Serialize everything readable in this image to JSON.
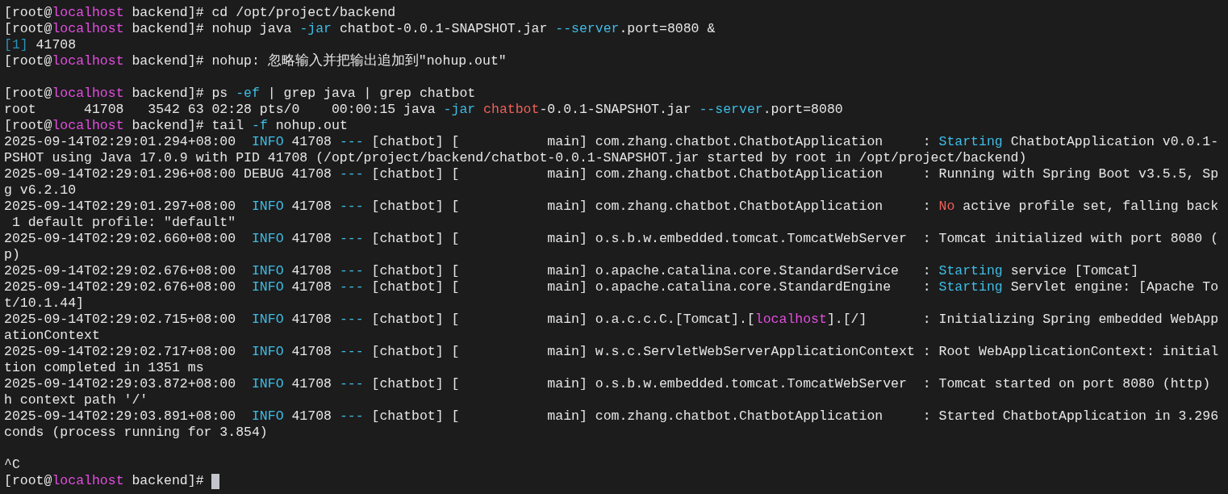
{
  "terminal": {
    "cursor_visible": true,
    "lines": [
      {
        "kind": "text",
        "segments": [
          {
            "text": "[root@"
          },
          {
            "text": "localhost",
            "color": "#e24ee0"
          },
          {
            "text": " backend]# cd /opt/project/backend"
          }
        ]
      },
      {
        "kind": "text",
        "segments": [
          {
            "text": "[root@"
          },
          {
            "text": "localhost",
            "color": "#e24ee0"
          },
          {
            "text": " backend]# nohup java "
          },
          {
            "text": "-jar",
            "color": "#3ebde6"
          },
          {
            "text": " chatbot-0.0.1-SNAPSHOT.jar "
          },
          {
            "text": "--server",
            "color": "#3ebde6"
          },
          {
            "text": ".port=8080 &"
          }
        ]
      },
      {
        "kind": "text",
        "segments": [
          {
            "text": "[1]",
            "color": "#2a93b8"
          },
          {
            "text": " 41708"
          }
        ]
      },
      {
        "kind": "text",
        "segments": [
          {
            "text": "[root@"
          },
          {
            "text": "localhost",
            "color": "#e24ee0"
          },
          {
            "text": " backend]# nohup: 忽略输入并把输出追加到\"nohup.out\""
          }
        ]
      },
      {
        "kind": "blank"
      },
      {
        "kind": "text",
        "segments": [
          {
            "text": "[root@"
          },
          {
            "text": "localhost",
            "color": "#e24ee0"
          },
          {
            "text": " backend]# ps "
          },
          {
            "text": "-ef",
            "color": "#3ebde6"
          },
          {
            "text": " | grep java | grep chatbot"
          }
        ]
      },
      {
        "kind": "text",
        "segments": [
          {
            "text": "root      41708   3542 63 02:28 pts/0    00:00:15 java "
          },
          {
            "text": "-jar ",
            "color": "#3ebde6"
          },
          {
            "text": "chatbot",
            "color": "#f0605a"
          },
          {
            "text": "-0.0.1-SNAPSHOT.jar "
          },
          {
            "text": "--server",
            "color": "#3ebde6"
          },
          {
            "text": ".port=8080"
          }
        ]
      },
      {
        "kind": "text",
        "segments": [
          {
            "text": "[root@"
          },
          {
            "text": "localhost",
            "color": "#e24ee0"
          },
          {
            "text": " backend]# tail "
          },
          {
            "text": "-f",
            "color": "#3ebde6"
          },
          {
            "text": " nohup.out"
          }
        ]
      },
      {
        "kind": "text",
        "segments": [
          {
            "text": "2025-09-14T02:29:01.294+08:00  "
          },
          {
            "text": "INFO",
            "color": "#3ebde6"
          },
          {
            "text": " 41708 "
          },
          {
            "text": "---",
            "color": "#3ebde6"
          },
          {
            "text": " [chatbot] [           main] com.zhang.chatbot.ChatbotApplication     : "
          },
          {
            "text": "Starting",
            "color": "#3ebde6"
          },
          {
            "text": " ChatbotApplication v0.0.1-"
          }
        ]
      },
      {
        "kind": "text",
        "segments": [
          {
            "text": "PSHOT using Java 17.0.9 with PID 41708 (/opt/project/backend/chatbot-0.0.1-SNAPSHOT.jar started by root in /opt/project/backend)"
          }
        ]
      },
      {
        "kind": "text",
        "segments": [
          {
            "text": "2025-09-14T02:29:01.296+08:00 DEBUG 41708 "
          },
          {
            "text": "---",
            "color": "#3ebde6"
          },
          {
            "text": " [chatbot] [           main] com.zhang.chatbot.ChatbotApplication     : Running with Spring Boot v3.5.5, Sp"
          }
        ]
      },
      {
        "kind": "text",
        "segments": [
          {
            "text": "g v6.2.10"
          }
        ]
      },
      {
        "kind": "text",
        "segments": [
          {
            "text": "2025-09-14T02:29:01.297+08:00  "
          },
          {
            "text": "INFO",
            "color": "#3ebde6"
          },
          {
            "text": " 41708 "
          },
          {
            "text": "---",
            "color": "#3ebde6"
          },
          {
            "text": " [chatbot] [           main] com.zhang.chatbot.ChatbotApplication     : "
          },
          {
            "text": "No",
            "color": "#f0605a"
          },
          {
            "text": " active profile set, falling back"
          }
        ]
      },
      {
        "kind": "text",
        "segments": [
          {
            "text": " 1 default profile: \"default\""
          }
        ]
      },
      {
        "kind": "text",
        "segments": [
          {
            "text": "2025-09-14T02:29:02.660+08:00  "
          },
          {
            "text": "INFO",
            "color": "#3ebde6"
          },
          {
            "text": " 41708 "
          },
          {
            "text": "---",
            "color": "#3ebde6"
          },
          {
            "text": " [chatbot] [           main] o.s.b.w.embedded.tomcat.TomcatWebServer  : Tomcat initialized with port 8080 ("
          }
        ]
      },
      {
        "kind": "text",
        "segments": [
          {
            "text": "p)"
          }
        ]
      },
      {
        "kind": "text",
        "segments": [
          {
            "text": "2025-09-14T02:29:02.676+08:00  "
          },
          {
            "text": "INFO",
            "color": "#3ebde6"
          },
          {
            "text": " 41708 "
          },
          {
            "text": "---",
            "color": "#3ebde6"
          },
          {
            "text": " [chatbot] [           main] o.apache.catalina.core.StandardService   : "
          },
          {
            "text": "Starting",
            "color": "#3ebde6"
          },
          {
            "text": " service [Tomcat]"
          }
        ]
      },
      {
        "kind": "text",
        "segments": [
          {
            "text": "2025-09-14T02:29:02.676+08:00  "
          },
          {
            "text": "INFO",
            "color": "#3ebde6"
          },
          {
            "text": " 41708 "
          },
          {
            "text": "---",
            "color": "#3ebde6"
          },
          {
            "text": " [chatbot] [           main] o.apache.catalina.core.StandardEngine    : "
          },
          {
            "text": "Starting",
            "color": "#3ebde6"
          },
          {
            "text": " Servlet engine: [Apache To"
          }
        ]
      },
      {
        "kind": "text",
        "segments": [
          {
            "text": "t/10.1.44]"
          }
        ]
      },
      {
        "kind": "text",
        "segments": [
          {
            "text": "2025-09-14T02:29:02.715+08:00  "
          },
          {
            "text": "INFO",
            "color": "#3ebde6"
          },
          {
            "text": " 41708 "
          },
          {
            "text": "---",
            "color": "#3ebde6"
          },
          {
            "text": " [chatbot] [           main] o.a.c.c.C.[Tomcat].["
          },
          {
            "text": "localhost",
            "color": "#e24ee0"
          },
          {
            "text": "].[/]       : Initializing Spring embedded WebApp"
          }
        ]
      },
      {
        "kind": "text",
        "segments": [
          {
            "text": "ationContext"
          }
        ]
      },
      {
        "kind": "text",
        "segments": [
          {
            "text": "2025-09-14T02:29:02.717+08:00  "
          },
          {
            "text": "INFO",
            "color": "#3ebde6"
          },
          {
            "text": " 41708 "
          },
          {
            "text": "---",
            "color": "#3ebde6"
          },
          {
            "text": " [chatbot] [           main] w.s.c.ServletWebServerApplicationContext : Root WebApplicationContext: initial"
          }
        ]
      },
      {
        "kind": "text",
        "segments": [
          {
            "text": "tion completed in 1351 ms"
          }
        ]
      },
      {
        "kind": "text",
        "segments": [
          {
            "text": "2025-09-14T02:29:03.872+08:00  "
          },
          {
            "text": "INFO",
            "color": "#3ebde6"
          },
          {
            "text": " 41708 "
          },
          {
            "text": "---",
            "color": "#3ebde6"
          },
          {
            "text": " [chatbot] [           main] o.s.b.w.embedded.tomcat.TomcatWebServer  : Tomcat started on port 8080 (http)"
          }
        ]
      },
      {
        "kind": "text",
        "segments": [
          {
            "text": "h context path '/'"
          }
        ]
      },
      {
        "kind": "text",
        "segments": [
          {
            "text": "2025-09-14T02:29:03.891+08:00  "
          },
          {
            "text": "INFO",
            "color": "#3ebde6"
          },
          {
            "text": " 41708 "
          },
          {
            "text": "---",
            "color": "#3ebde6"
          },
          {
            "text": " [chatbot] [           main] com.zhang.chatbot.ChatbotApplication     : Started ChatbotApplication in 3.296"
          }
        ]
      },
      {
        "kind": "text",
        "segments": [
          {
            "text": "conds (process running for 3.854)"
          }
        ]
      },
      {
        "kind": "blank"
      },
      {
        "kind": "text",
        "segments": [
          {
            "text": "^C"
          }
        ]
      },
      {
        "kind": "text",
        "segments": [
          {
            "text": "[root@"
          },
          {
            "text": "localhost",
            "color": "#e24ee0"
          },
          {
            "text": " backend]# "
          }
        ]
      }
    ]
  }
}
